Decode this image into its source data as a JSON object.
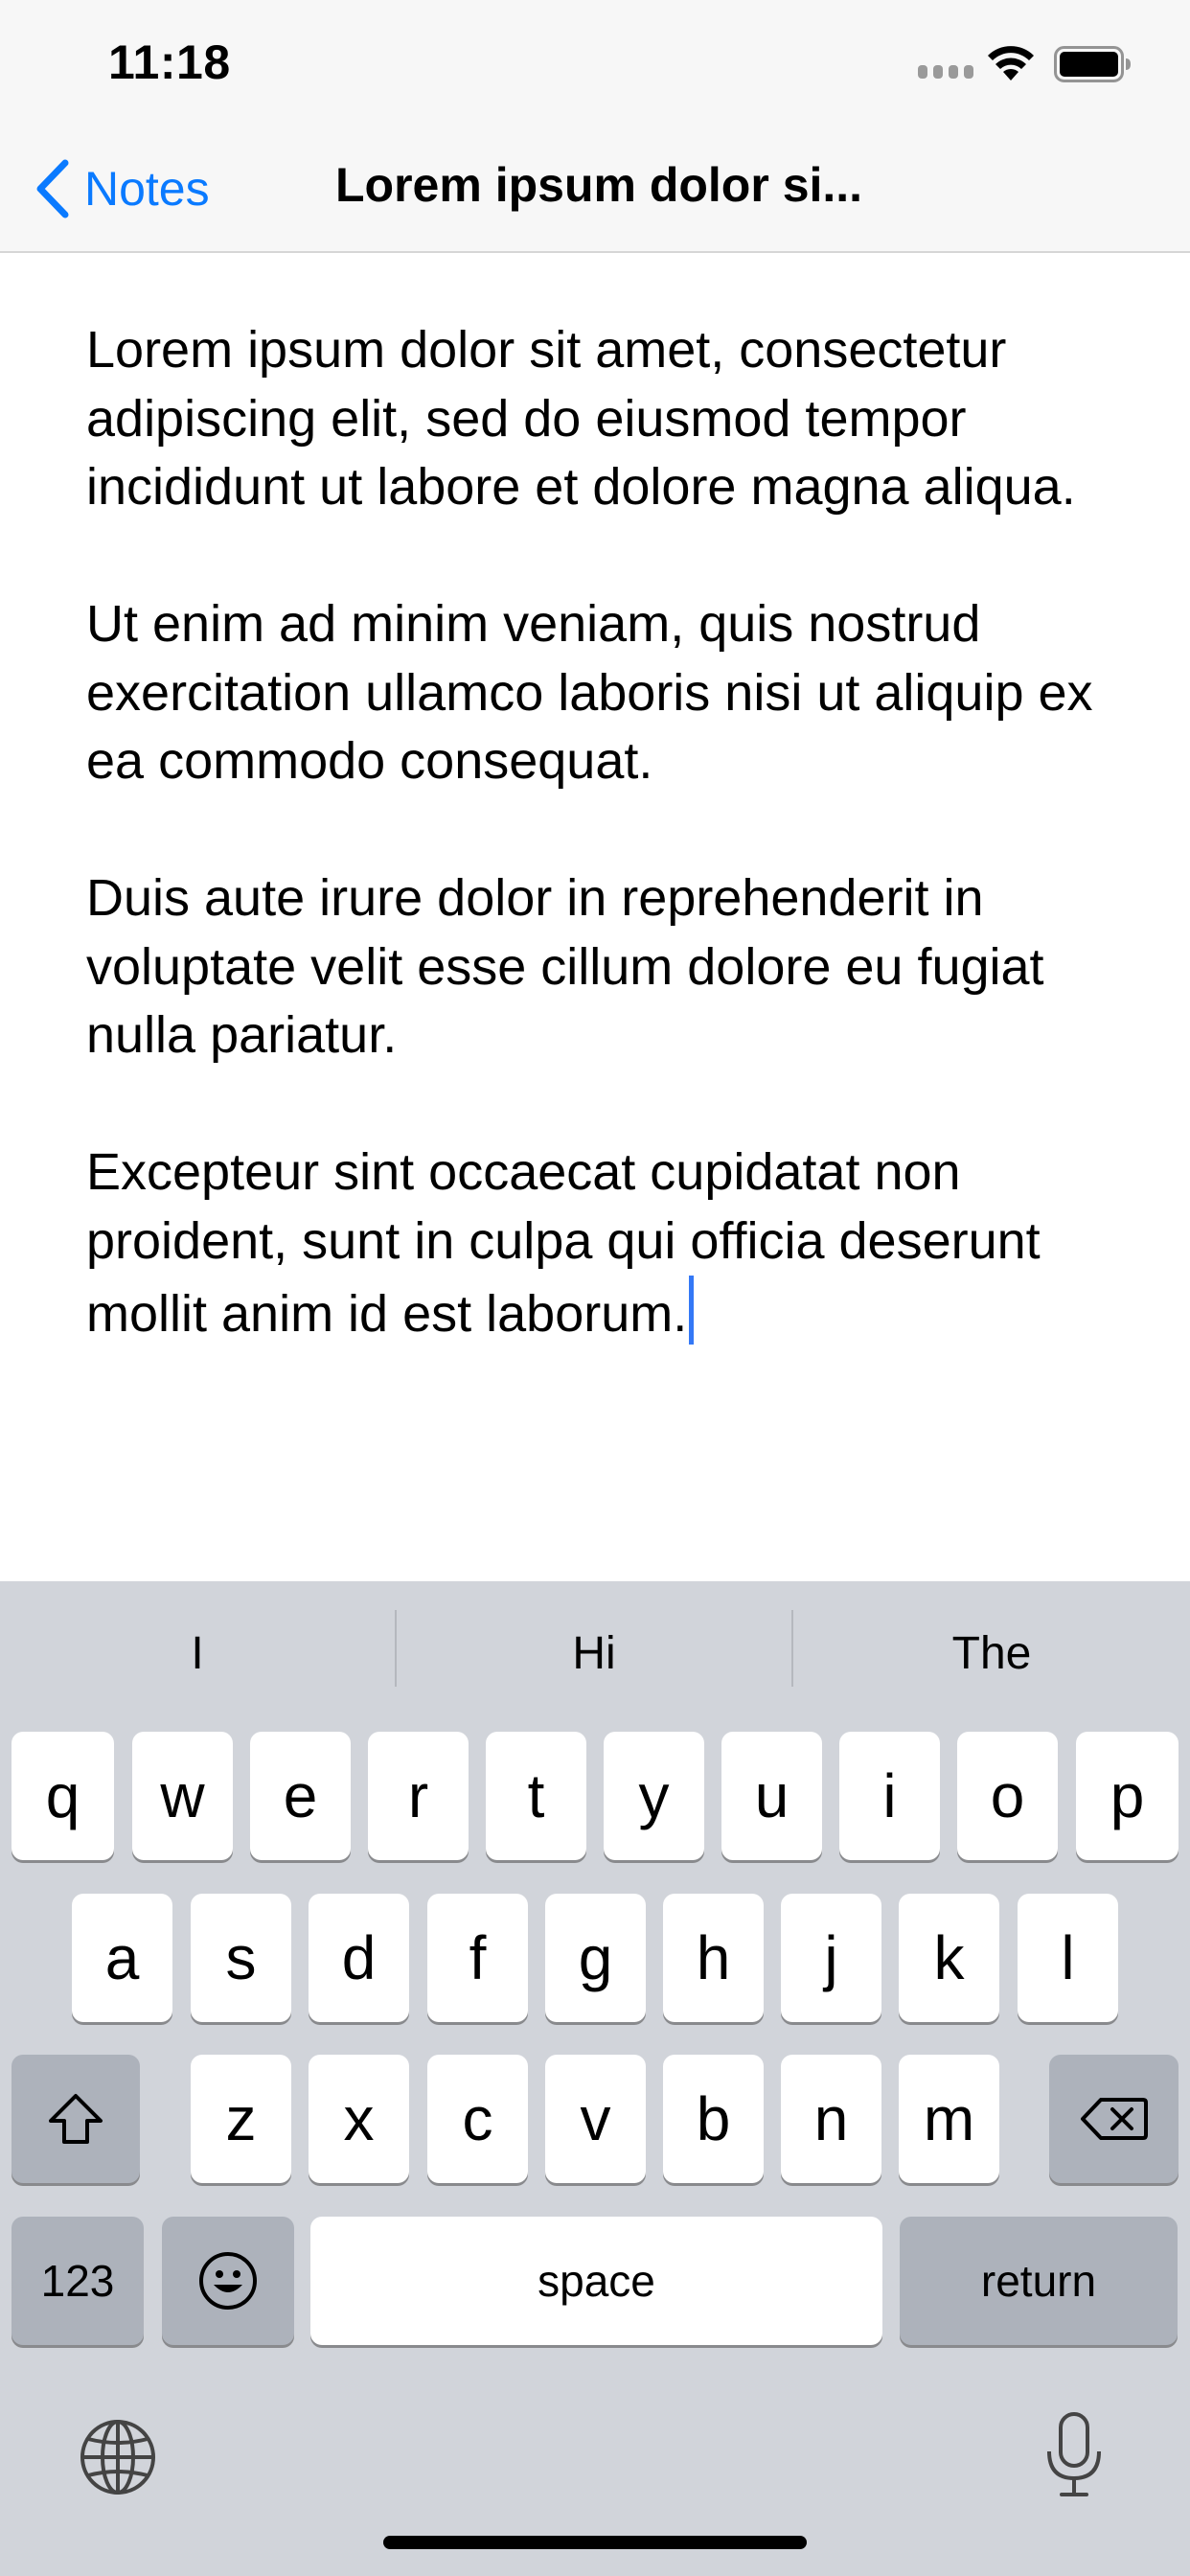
{
  "status_bar": {
    "time": "11:18"
  },
  "nav": {
    "back_label": "Notes",
    "title": "Lorem ipsum dolor si..."
  },
  "note": {
    "paragraphs": [
      "Lorem ipsum dolor sit amet, consectetur adipiscing elit, sed do eiusmod tempor incididunt ut labore et dolore magna aliqua.",
      "Ut enim ad minim veniam, quis nostrud exercitation ullamco laboris nisi ut aliquip ex ea commodo consequat.",
      "Duis aute irure dolor in reprehenderit in voluptate velit esse cillum dolore eu fugiat nulla pariatur.",
      "Excepteur sint occaecat cupidatat non proident, sunt in culpa qui officia deserunt mollit anim id est laborum."
    ]
  },
  "keyboard": {
    "suggestions": [
      "I",
      "Hi",
      "The"
    ],
    "row1": [
      "q",
      "w",
      "e",
      "r",
      "t",
      "y",
      "u",
      "i",
      "o",
      "p"
    ],
    "row2": [
      "a",
      "s",
      "d",
      "f",
      "g",
      "h",
      "j",
      "k",
      "l"
    ],
    "row3": [
      "z",
      "x",
      "c",
      "v",
      "b",
      "n",
      "m"
    ],
    "numbers_label": "123",
    "space_label": "space",
    "return_label": "return"
  },
  "icons": {
    "back": "chevron-left-icon",
    "wifi": "wifi-icon",
    "battery": "battery-icon",
    "signal": "cellular-signal-icon",
    "shift": "shift-arrow-icon",
    "delete": "backspace-icon",
    "emoji": "emoji-smiley-icon",
    "globe": "globe-icon",
    "dictation": "microphone-icon"
  },
  "colors": {
    "accent": "#0a7aff",
    "caret": "#3478f6",
    "keyboard_bg": "#d1d4da"
  }
}
